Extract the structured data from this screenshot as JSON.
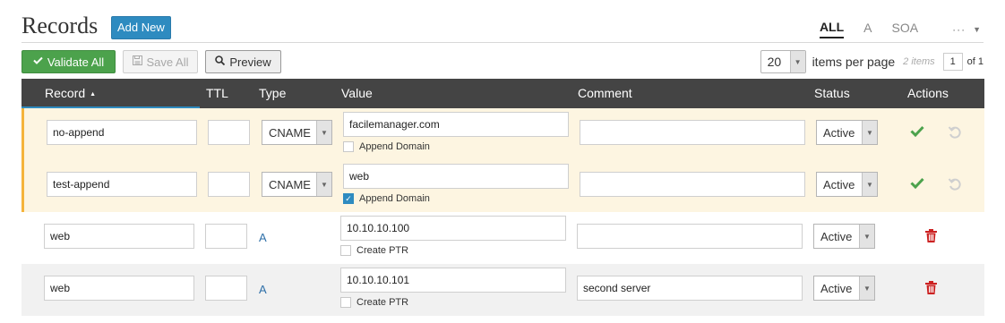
{
  "header": {
    "title": "Records",
    "add_new_label": "Add New",
    "filters": [
      "ALL",
      "A",
      "SOA"
    ],
    "active_filter": "ALL",
    "more_label": "···"
  },
  "toolbar": {
    "validate_label": "Validate All",
    "save_label": "Save All",
    "preview_label": "Preview"
  },
  "pager": {
    "per_page": "20",
    "per_page_label": "items per page",
    "item_count": "2 items",
    "page": "1",
    "of_label": "of 1"
  },
  "columns": {
    "record": "Record",
    "ttl": "TTL",
    "type": "Type",
    "value": "Value",
    "comment": "Comment",
    "status": "Status",
    "actions": "Actions"
  },
  "rows": [
    {
      "record": "no-append",
      "ttl": "",
      "type": "CNAME",
      "value": "facilemanager.com",
      "option_label": "Append Domain",
      "option_checked": false,
      "comment": "",
      "status": "Active"
    },
    {
      "record": "test-append",
      "ttl": "",
      "type": "CNAME",
      "value": "web",
      "option_label": "Append Domain",
      "option_checked": true,
      "comment": "",
      "status": "Active"
    },
    {
      "record": "web",
      "ttl": "",
      "type": "A",
      "value": "10.10.10.100",
      "option_label": "Create PTR",
      "option_checked": false,
      "comment": "",
      "status": "Active"
    },
    {
      "record": "web",
      "ttl": "",
      "type": "A",
      "value": "10.10.10.101",
      "option_label": "Create PTR",
      "option_checked": false,
      "comment": "second server",
      "status": "Active"
    }
  ],
  "colors": {
    "header_bg": "#444444",
    "primary": "#2e8bc0",
    "success": "#4ca24c",
    "danger": "#cc2222",
    "editing_bg": "#fdf5e1",
    "editing_border": "#f5b43b"
  },
  "icons": {
    "validate": "check-icon",
    "save": "floppy-disk-icon",
    "preview": "magnifier-icon",
    "confirm": "check-icon",
    "revert": "undo-icon",
    "delete": "trash-icon"
  }
}
